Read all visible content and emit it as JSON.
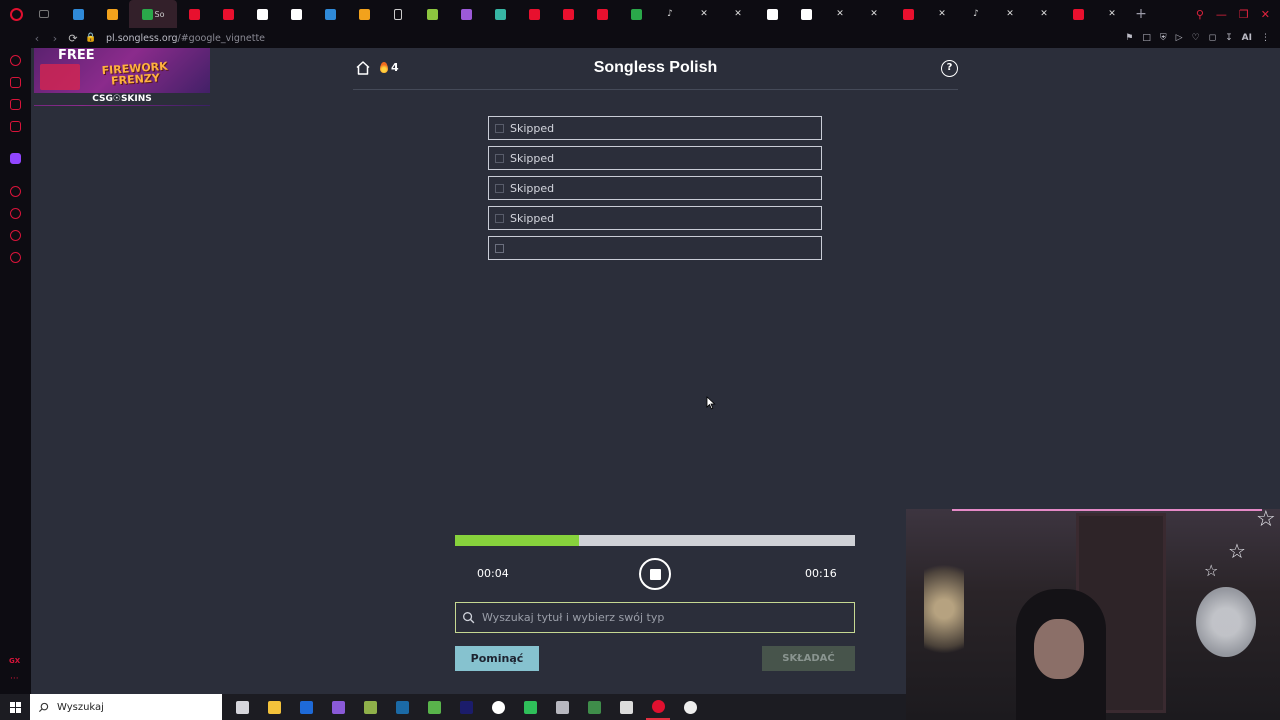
{
  "browser": {
    "active_tab_label": "So",
    "tab_favicons": [
      "tab-icon-1",
      "tab-icon-2",
      "tab-icon-3",
      "youtube-icon",
      "youtube-icon",
      "google-icon",
      "tab-icon-4",
      "tab-icon-5",
      "tab-icon-6",
      "page-icon",
      "tab-icon-7",
      "tab-icon-8",
      "tab-icon-9",
      "youtube-icon",
      "youtube-icon",
      "youtube-icon",
      "tab-icon-10",
      "tiktok-icon",
      "x-icon",
      "x-icon",
      "google-icon",
      "w-icon",
      "x-icon",
      "x-icon",
      "youtube-icon",
      "x-icon",
      "tiktok-icon",
      "x-icon",
      "x-icon",
      "youtube-icon",
      "x-icon"
    ],
    "new_tab_symbol": "+",
    "url_host": "pl.songless.org",
    "url_path": "/#google_vignette",
    "ai_label": "AI"
  },
  "ad": {
    "free": "FREE",
    "line1": "FIREWORK",
    "line2": "FRENZY",
    "brand": "CSG☉SKINS"
  },
  "header": {
    "streak": "4",
    "title": "Songless Polish",
    "help": "?"
  },
  "guesses": [
    {
      "label": "Skipped"
    },
    {
      "label": "Skipped"
    },
    {
      "label": "Skipped"
    },
    {
      "label": "Skipped"
    },
    {
      "label": ""
    }
  ],
  "player": {
    "progress_fraction": 0.31,
    "elapsed": "00:04",
    "total": "00:16"
  },
  "search": {
    "placeholder": "Wyszukaj tytuł i wybierz swój typ",
    "value": ""
  },
  "actions": {
    "skip": "Pominąć",
    "submit": "SKŁADAĆ"
  },
  "taskbar": {
    "search_label": "Wyszukaj",
    "apps": [
      "task-view-icon",
      "file-explorer-icon",
      "app-icon-m",
      "obsidian-icon",
      "gaming-app-icon",
      "steam-icon",
      "notepad-icon",
      "premiere-icon",
      "steelseries-icon",
      "gg-icon",
      "app-icon-gray",
      "app-icon-green",
      "app-icon-white",
      "opera-gx-icon",
      "obs-icon"
    ]
  },
  "colors": {
    "page_bg": "#2b2e3a",
    "progress_fill": "#87d23c",
    "skip_button": "#86c2cf",
    "submit_button": "#47544b",
    "opera_red": "#e0102f"
  }
}
